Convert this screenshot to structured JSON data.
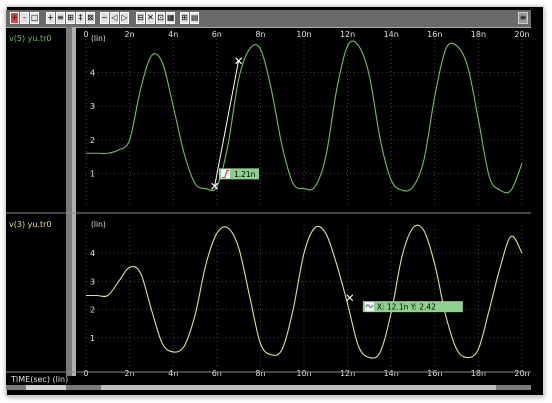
{
  "panels": [
    {
      "signal_label": "v(5) yu.tr0",
      "y_unit_label": "(lin)",
      "y_ticks": [
        "1",
        "2",
        "3",
        "4"
      ],
      "color": "#6fbf5e",
      "measure": {
        "label": "1.21n"
      }
    },
    {
      "signal_label": "v(3) yu.tr0",
      "y_unit_label": "(lin)",
      "y_ticks": [
        "1",
        "2",
        "3",
        "4"
      ],
      "color": "#e6e07a",
      "measure": {
        "label": "X: 12.1n  Y: 2.42"
      }
    }
  ],
  "x_axis": {
    "label": "TIME(sec) (lin)",
    "tick_labels": [
      "0",
      "2n",
      "4n",
      "6n",
      "8n",
      "10n",
      "12n",
      "14n",
      "16n",
      "18n",
      "20n"
    ]
  },
  "colors": {
    "grid": "#5a5a5a",
    "measure_box": "#8ed08e",
    "marker": "#ffffff"
  },
  "chart_data": [
    {
      "type": "line",
      "title": "",
      "xlabel": "TIME(sec) (lin)",
      "ylabel": "(lin)",
      "xlim": [
        0,
        20
      ],
      "ylim": [
        0,
        5
      ],
      "series": [
        {
          "name": "v(5) yu.tr0",
          "x": [
            0,
            0.5,
            1,
            1.5,
            2,
            2.5,
            3,
            3.5,
            4,
            4.5,
            5,
            5.5,
            6,
            6.5,
            7,
            7.5,
            8,
            8.5,
            9,
            9.5,
            10,
            10.5,
            11,
            11.5,
            12,
            12.5,
            13,
            13.5,
            14,
            14.5,
            15,
            15.5,
            16,
            16.5,
            17,
            17.5,
            18,
            18.5,
            19,
            19.5,
            20
          ],
          "y": [
            1.6,
            1.6,
            1.6,
            1.7,
            2.0,
            3.5,
            4.5,
            4.3,
            3.0,
            1.6,
            0.7,
            0.55,
            0.6,
            1.8,
            3.8,
            4.7,
            4.7,
            3.5,
            1.8,
            0.7,
            0.55,
            0.6,
            1.5,
            3.5,
            4.8,
            4.8,
            3.9,
            2.0,
            0.8,
            0.5,
            0.6,
            1.4,
            3.3,
            4.7,
            4.8,
            4.2,
            2.6,
            0.9,
            0.5,
            0.5,
            1.3
          ]
        },
        {
          "name": "v(3) yu.tr0",
          "x": [
            0,
            0.5,
            1,
            1.5,
            2,
            2.5,
            3,
            3.5,
            4,
            4.5,
            5,
            5.5,
            6,
            6.5,
            7,
            7.5,
            8,
            8.5,
            9,
            9.5,
            10,
            10.5,
            11,
            11.5,
            12,
            12.5,
            13,
            13.5,
            14,
            14.5,
            15,
            15.5,
            16,
            16.5,
            17,
            17.5,
            18,
            18.5,
            19,
            19.5,
            20
          ],
          "y": [
            2.5,
            2.5,
            2.5,
            3.0,
            3.5,
            3.3,
            2.0,
            0.8,
            0.5,
            0.7,
            1.8,
            3.6,
            4.7,
            4.9,
            4.2,
            2.5,
            0.8,
            0.4,
            0.6,
            2.0,
            4.0,
            4.9,
            4.7,
            3.6,
            2.2,
            0.7,
            0.3,
            0.5,
            1.9,
            3.9,
            4.9,
            4.8,
            3.6,
            1.8,
            0.6,
            0.3,
            0.6,
            2.0,
            3.5,
            4.6,
            4.0
          ]
        }
      ]
    }
  ]
}
